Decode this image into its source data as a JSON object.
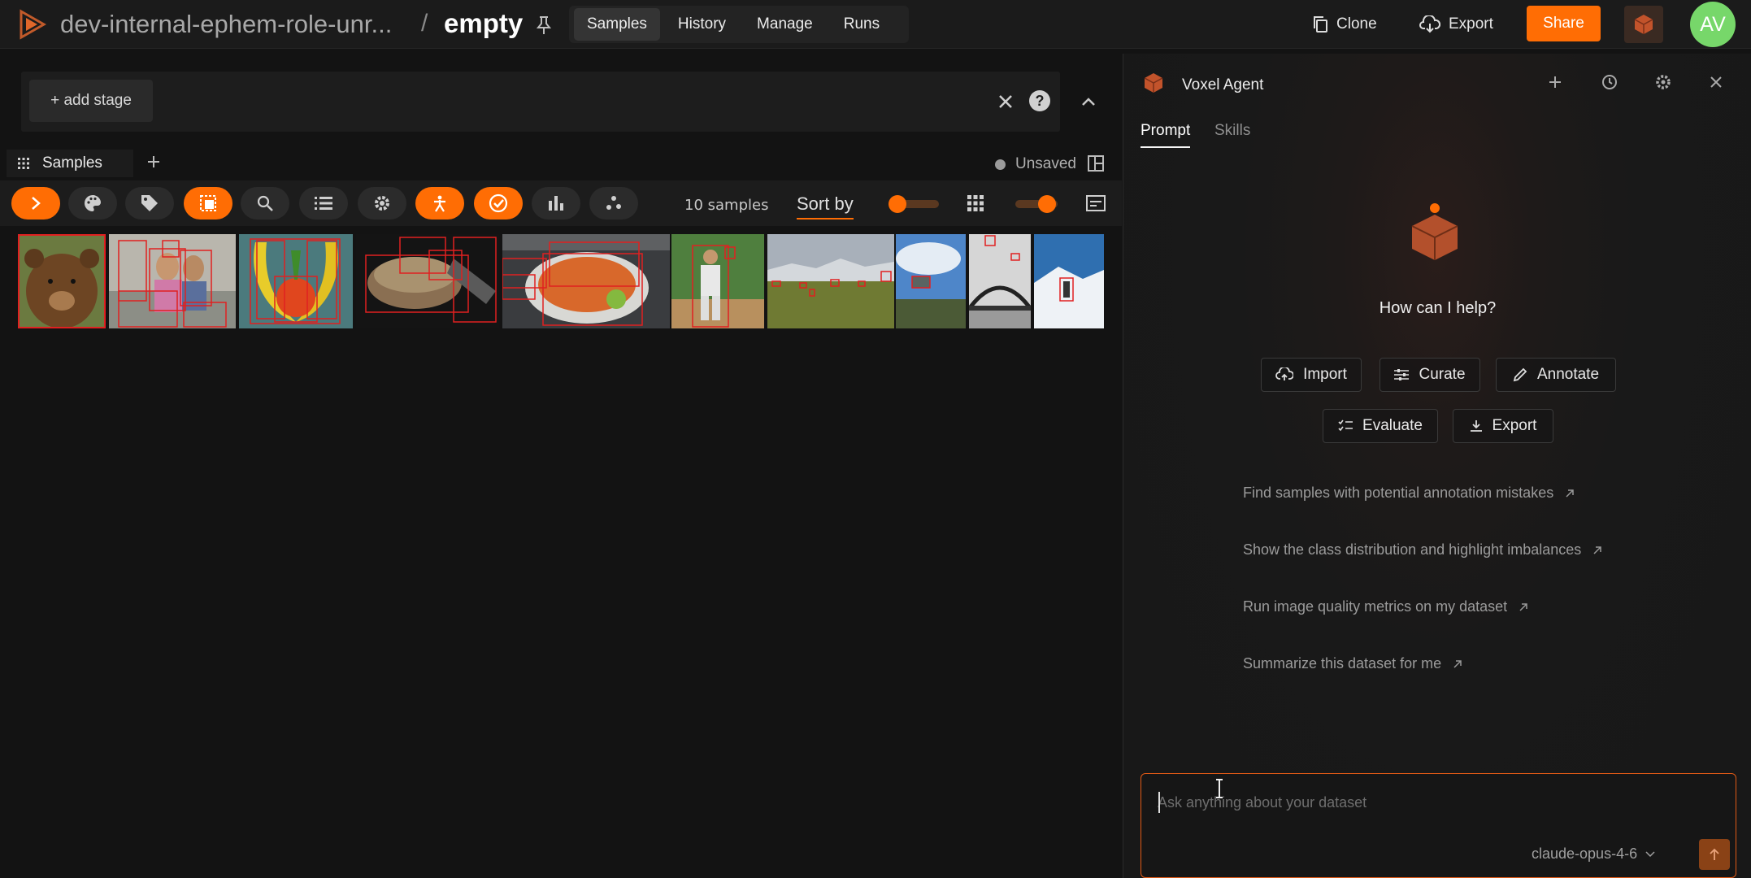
{
  "header": {
    "dataset_name": "dev-internal-ephem-role-unr...",
    "separator": "/",
    "view_name": "empty",
    "tabs": [
      {
        "label": "Samples",
        "active": true
      },
      {
        "label": "History",
        "active": false
      },
      {
        "label": "Manage",
        "active": false
      },
      {
        "label": "Runs",
        "active": false
      }
    ],
    "clone_label": "Clone",
    "export_label": "Export",
    "share_label": "Share",
    "avatar_initials": "AV",
    "accent": "#ff6d04",
    "avatar_color": "#77d76a"
  },
  "view_bar": {
    "add_stage_label": "+ add stage"
  },
  "panel": {
    "tab_label": "Samples",
    "unsaved_label": "Unsaved"
  },
  "toolbar": {
    "buttons": [
      "expand-icon",
      "palette-icon",
      "tag-icon",
      "selection-icon",
      "search-icon",
      "list-icon",
      "gear-icon",
      "person-icon",
      "check-icon",
      "bar-chart-icon",
      "embeddings-icon"
    ],
    "sample_count": "10 samples",
    "sort_label": "Sort by"
  },
  "samples": [
    {
      "name": "bear"
    },
    {
      "name": "children"
    },
    {
      "name": "fruit"
    },
    {
      "name": "sandwich"
    },
    {
      "name": "plate-of-food"
    },
    {
      "name": "baseball-player"
    },
    {
      "name": "field"
    },
    {
      "name": "sky-kite"
    },
    {
      "name": "bridge"
    },
    {
      "name": "snow-skier"
    }
  ],
  "agent": {
    "title": "Voxel Agent",
    "tabs": [
      {
        "label": "Prompt",
        "active": true
      },
      {
        "label": "Skills",
        "active": false
      }
    ],
    "help_text": "How can I help?",
    "actions": [
      {
        "label": "Import",
        "icon": "cloud-upload-icon"
      },
      {
        "label": "Curate",
        "icon": "sliders-icon"
      },
      {
        "label": "Annotate",
        "icon": "pencil-icon"
      },
      {
        "label": "Evaluate",
        "icon": "checklist-icon"
      },
      {
        "label": "Export",
        "icon": "download-icon"
      }
    ],
    "suggestions": [
      "Find samples with potential annotation mistakes",
      "Show the class distribution and highlight imbalances",
      "Run image quality metrics on my dataset",
      "Summarize this dataset for me"
    ],
    "input_placeholder": "Ask anything about your dataset",
    "model": "claude-opus-4-6"
  }
}
